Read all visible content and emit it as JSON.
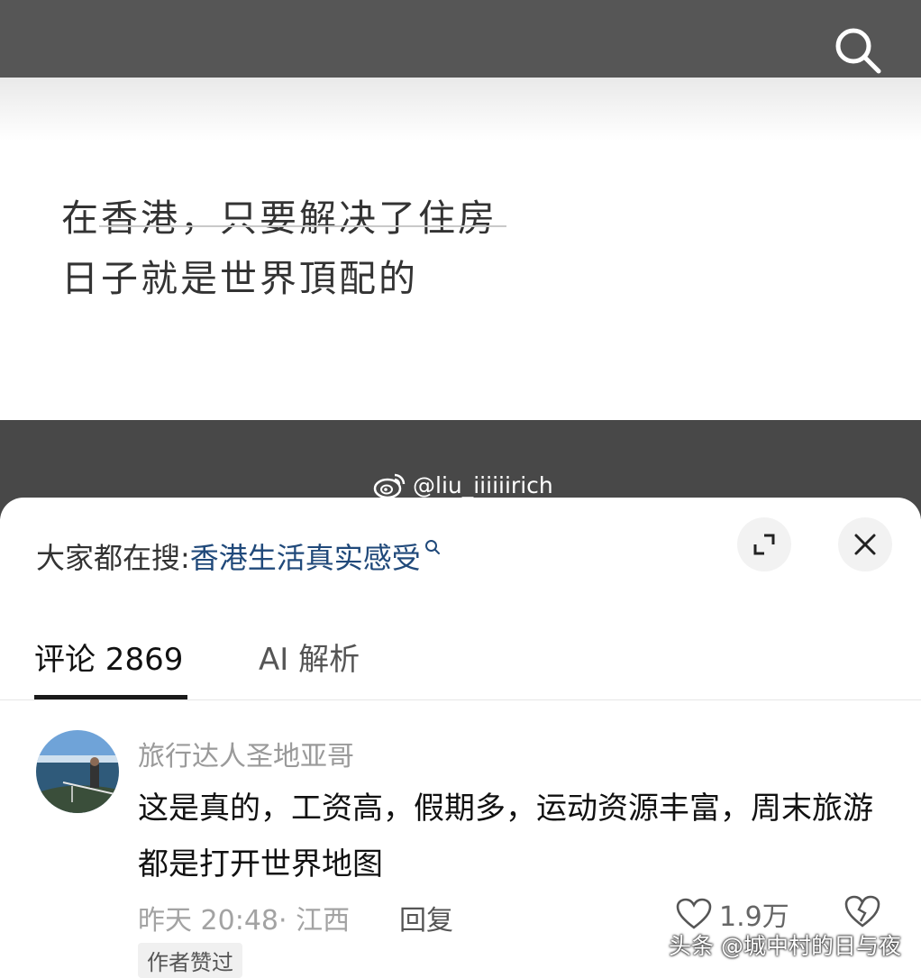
{
  "topbar": {
    "search_icon": "search-icon"
  },
  "video": {
    "quote_line1": "在香港，只要解决了住房",
    "quote_line2": "日子就是世界頂配的",
    "watermark": "@liu_iiiiiirich",
    "watermark_icon": "weibo-icon"
  },
  "sheet": {
    "hot_search_prefix": "大家都在搜:",
    "hot_search_term": "香港生活真实感受",
    "expand_icon": "expand-icon",
    "close_icon": "close-icon",
    "tabs": [
      {
        "label": "评论 2869",
        "active": true
      },
      {
        "label": "AI 解析",
        "active": false
      }
    ]
  },
  "comment": {
    "author": "旅行达人圣地亚哥",
    "text": "这是真的，工资高，假期多，运动资源丰富，周末旅游都是打开世界地图",
    "time_location": "昨天 20:48· 江西",
    "reply_label": "回复",
    "likes": "1.9万",
    "badge": "作者赞过"
  },
  "source_watermark": "头条 @城中村的日与夜",
  "colors": {
    "link": "#20497a",
    "topbar": "#565656",
    "band": "#484848"
  }
}
